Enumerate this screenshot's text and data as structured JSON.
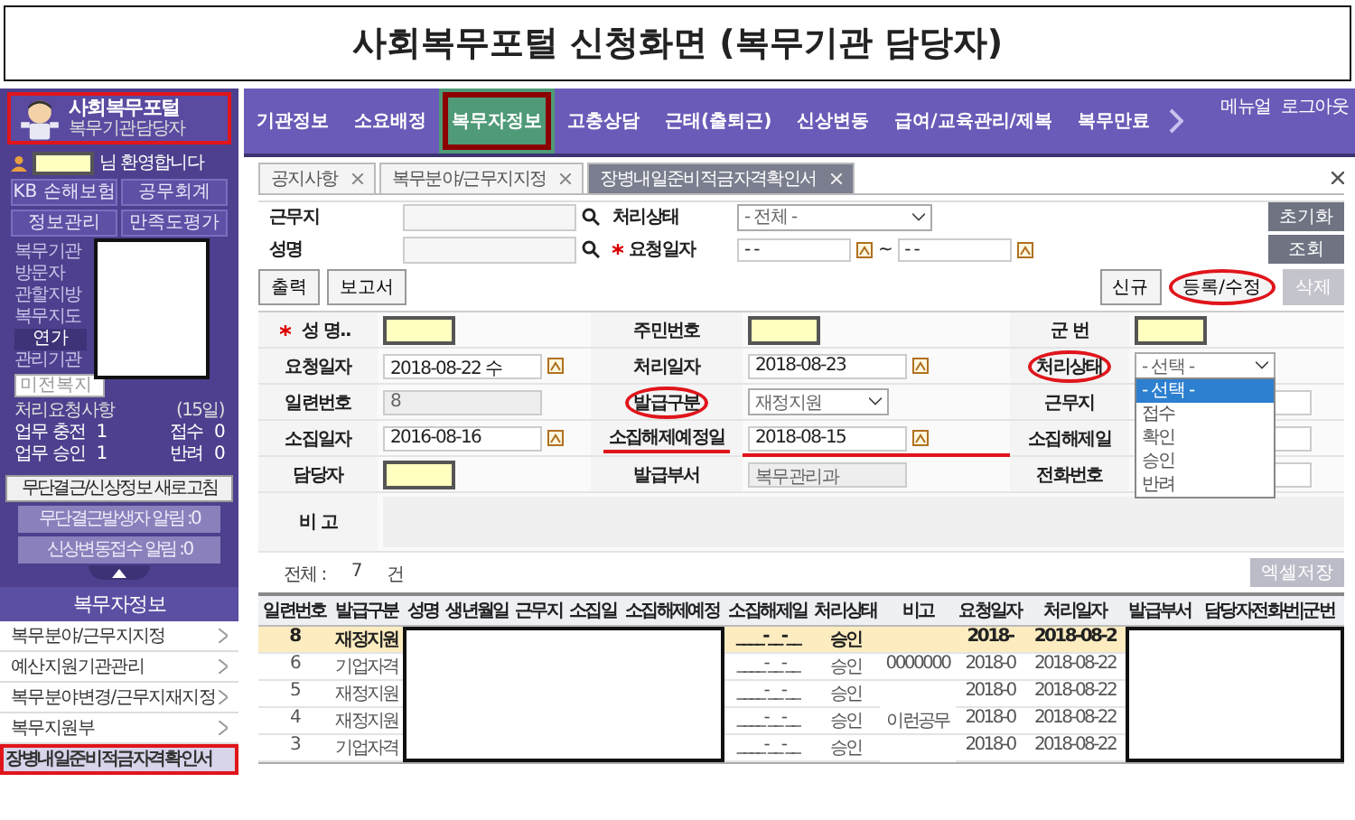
{
  "title": "사회복무포털 신청화면 (복무기관 담당자)",
  "logo": {
    "title": "사회복무포털",
    "subtitle": "복무기관담당자",
    "boxed": true
  },
  "sidebar": {
    "greeting": "님 환영합니다",
    "quick_buttons": [
      "KB 손해보험",
      "공무회계",
      "정보관리",
      "만족도평가"
    ],
    "menu": [
      {
        "label": "복무기관",
        "kind": "link"
      },
      {
        "label": "방문자",
        "kind": "link"
      },
      {
        "label": "관할지방",
        "kind": "link"
      },
      {
        "label": "복무지도",
        "kind": "link"
      },
      {
        "label": "연가",
        "kind": "button"
      },
      {
        "label": "관리기관",
        "kind": "link"
      }
    ],
    "menu_search": {
      "placeholder": "미전복지"
    },
    "requests": {
      "title": "처리요청사항",
      "period": "(15일)",
      "stats": [
        {
          "label": "업무 충전",
          "value": "1"
        },
        {
          "label": "접수",
          "value": "0"
        },
        {
          "label": "업무 승인",
          "value": "1"
        },
        {
          "label": "반려",
          "value": "0"
        }
      ]
    },
    "actions": [
      {
        "label": "무단결근/신상정보 새로고침",
        "disabled": false
      },
      {
        "label": "무단결근발생자 알림 :",
        "count": "0",
        "disabled": true
      },
      {
        "label": "신상변동접수 알림 :",
        "count": "0",
        "disabled": true
      }
    ],
    "section": {
      "title": "복무자정보",
      "items": [
        {
          "label": "복무분야/근무지지정",
          "selected": false,
          "boxed": false
        },
        {
          "label": "예산지원기관관리",
          "selected": false,
          "boxed": false
        },
        {
          "label": "복무분야변경/근무지재지정",
          "selected": false,
          "boxed": false
        },
        {
          "label": "복무지원부",
          "selected": false,
          "boxed": false
        },
        {
          "label": "장병내일준비적금자격확인서",
          "selected": true,
          "boxed": true
        }
      ]
    }
  },
  "nav": {
    "items": [
      {
        "label": "기관정보",
        "selected": false,
        "boxed": false
      },
      {
        "label": "소요배정",
        "selected": false,
        "boxed": false
      },
      {
        "label": "복무자정보",
        "selected": true,
        "boxed": true
      },
      {
        "label": "고충상담",
        "selected": false,
        "boxed": false
      },
      {
        "label": "근태(출퇴근)",
        "selected": false,
        "boxed": false
      },
      {
        "label": "신상변동",
        "selected": false,
        "boxed": false
      },
      {
        "label": "급여/교육관리/제복",
        "selected": false,
        "boxed": false
      },
      {
        "label": "복무만료",
        "selected": false,
        "boxed": false
      }
    ],
    "user_links": [
      "메뉴얼",
      "로그아웃"
    ]
  },
  "tabs": [
    {
      "label": "공지사항",
      "selected": false
    },
    {
      "label": "복무분야/근무지지정",
      "selected": false
    },
    {
      "label": "장병내일준비적금자격확인서",
      "selected": true
    }
  ],
  "search": {
    "fields": [
      {
        "label": "근무지",
        "kind": "lookup",
        "required": false
      },
      {
        "label": "처리상태",
        "kind": "select",
        "value": "- 전체 -",
        "required": false
      },
      {
        "label": "성명",
        "kind": "lookup",
        "required": false
      },
      {
        "label": "요청일자",
        "kind": "daterange",
        "required": true,
        "from": "- -",
        "separator": "~",
        "to": "- -"
      }
    ],
    "buttons": [
      "초기화",
      "조회"
    ]
  },
  "toolbar": {
    "left": [
      "출력",
      "보고서"
    ],
    "right": [
      {
        "label": "신규",
        "disabled": false,
        "circled": false
      },
      {
        "label": "등록/수정",
        "disabled": false,
        "circled": true
      },
      {
        "label": "삭제",
        "disabled": true,
        "circled": false
      }
    ]
  },
  "form": [
    {
      "label": "성 명..",
      "required": true,
      "kind": "masked",
      "circled": false,
      "underlined": false
    },
    {
      "label": "주민번호",
      "required": false,
      "kind": "masked",
      "circled": false,
      "underlined": false
    },
    {
      "label": "군 번",
      "required": false,
      "kind": "masked",
      "circled": false,
      "underlined": false
    },
    {
      "label": "요청일자",
      "required": false,
      "kind": "date",
      "value": "2018-08-22 수",
      "circled": false,
      "underlined": false
    },
    {
      "label": "처리일자",
      "required": false,
      "kind": "date",
      "value": "2018-08-23",
      "circled": false,
      "underlined": false
    },
    {
      "label": "처리상태",
      "required": false,
      "kind": "select",
      "value": "- 선택 -",
      "circled": true,
      "underlined": false,
      "options": [
        {
          "label": "- 선택 -",
          "selected": true
        },
        {
          "label": "접수",
          "selected": false
        },
        {
          "label": "확인",
          "selected": false
        },
        {
          "label": "승인",
          "selected": false
        },
        {
          "label": "반려",
          "selected": false
        }
      ]
    },
    {
      "label": "일련번호",
      "required": false,
      "kind": "readonly",
      "value": "8",
      "circled": false,
      "underlined": false
    },
    {
      "label": "발급구분",
      "required": false,
      "kind": "select",
      "value": "재정지원",
      "circled": true,
      "underlined": false
    },
    {
      "label": "근무지",
      "required": false,
      "kind": "text",
      "circled": false,
      "underlined": false
    },
    {
      "label": "소집일자",
      "required": false,
      "kind": "date",
      "value": "2016-08-16",
      "circled": false,
      "underlined": false
    },
    {
      "label": "소집해제예정일",
      "required": false,
      "kind": "date",
      "value": "2018-08-15",
      "circled": false,
      "underlined": true
    },
    {
      "label": "소집해제일",
      "required": false,
      "kind": "text",
      "circled": false,
      "underlined": false
    },
    {
      "label": "담당자",
      "required": false,
      "kind": "masked",
      "circled": false,
      "underlined": false
    },
    {
      "label": "발급부서",
      "required": false,
      "kind": "readonly",
      "value": "복무관리과",
      "circled": false,
      "underlined": false
    },
    {
      "label": "전화번호",
      "required": false,
      "kind": "text",
      "circled": false,
      "underlined": false
    }
  ],
  "remarks_label": "비 고",
  "total": {
    "label": "전체 :",
    "count": "7",
    "unit": "건"
  },
  "export_button": "엑셀저장",
  "table": {
    "columns": [
      "일련번호",
      "발급구분",
      "성명",
      "생년월일",
      "근무지",
      "소집일",
      "소집해제예정",
      "소집해제일",
      "처리상태",
      "비고",
      "요청일자",
      "처리일자",
      "발급부서",
      "담당자전화번|군번"
    ],
    "rows": [
      {
        "no": "8",
        "type": "재정지원",
        "discharge": "____-__-__",
        "status": "승인",
        "requested": "2018-",
        "processed": "2018-08-2",
        "selected": true
      },
      {
        "no": "6",
        "type": "기업자격",
        "discharge": "____-__-__",
        "status": "승인",
        "note": "0000000",
        "requested": "2018-0",
        "processed": "2018-08-22",
        "selected": false
      },
      {
        "no": "5",
        "type": "재정지원",
        "discharge": "____-__-__",
        "status": "승인",
        "requested": "2018-0",
        "processed": "2018-08-22",
        "selected": false
      },
      {
        "no": "4",
        "type": "재정지원",
        "discharge": "____-__-__",
        "status": "승인",
        "note": "이런공무",
        "requested": "2018-0",
        "processed": "2018-08-22",
        "selected": false
      },
      {
        "no": "3",
        "type": "기업자격",
        "discharge": "____-__-__",
        "status": "승인",
        "requested": "2018-0",
        "processed": "2018-08-22",
        "selected": false
      }
    ]
  }
}
